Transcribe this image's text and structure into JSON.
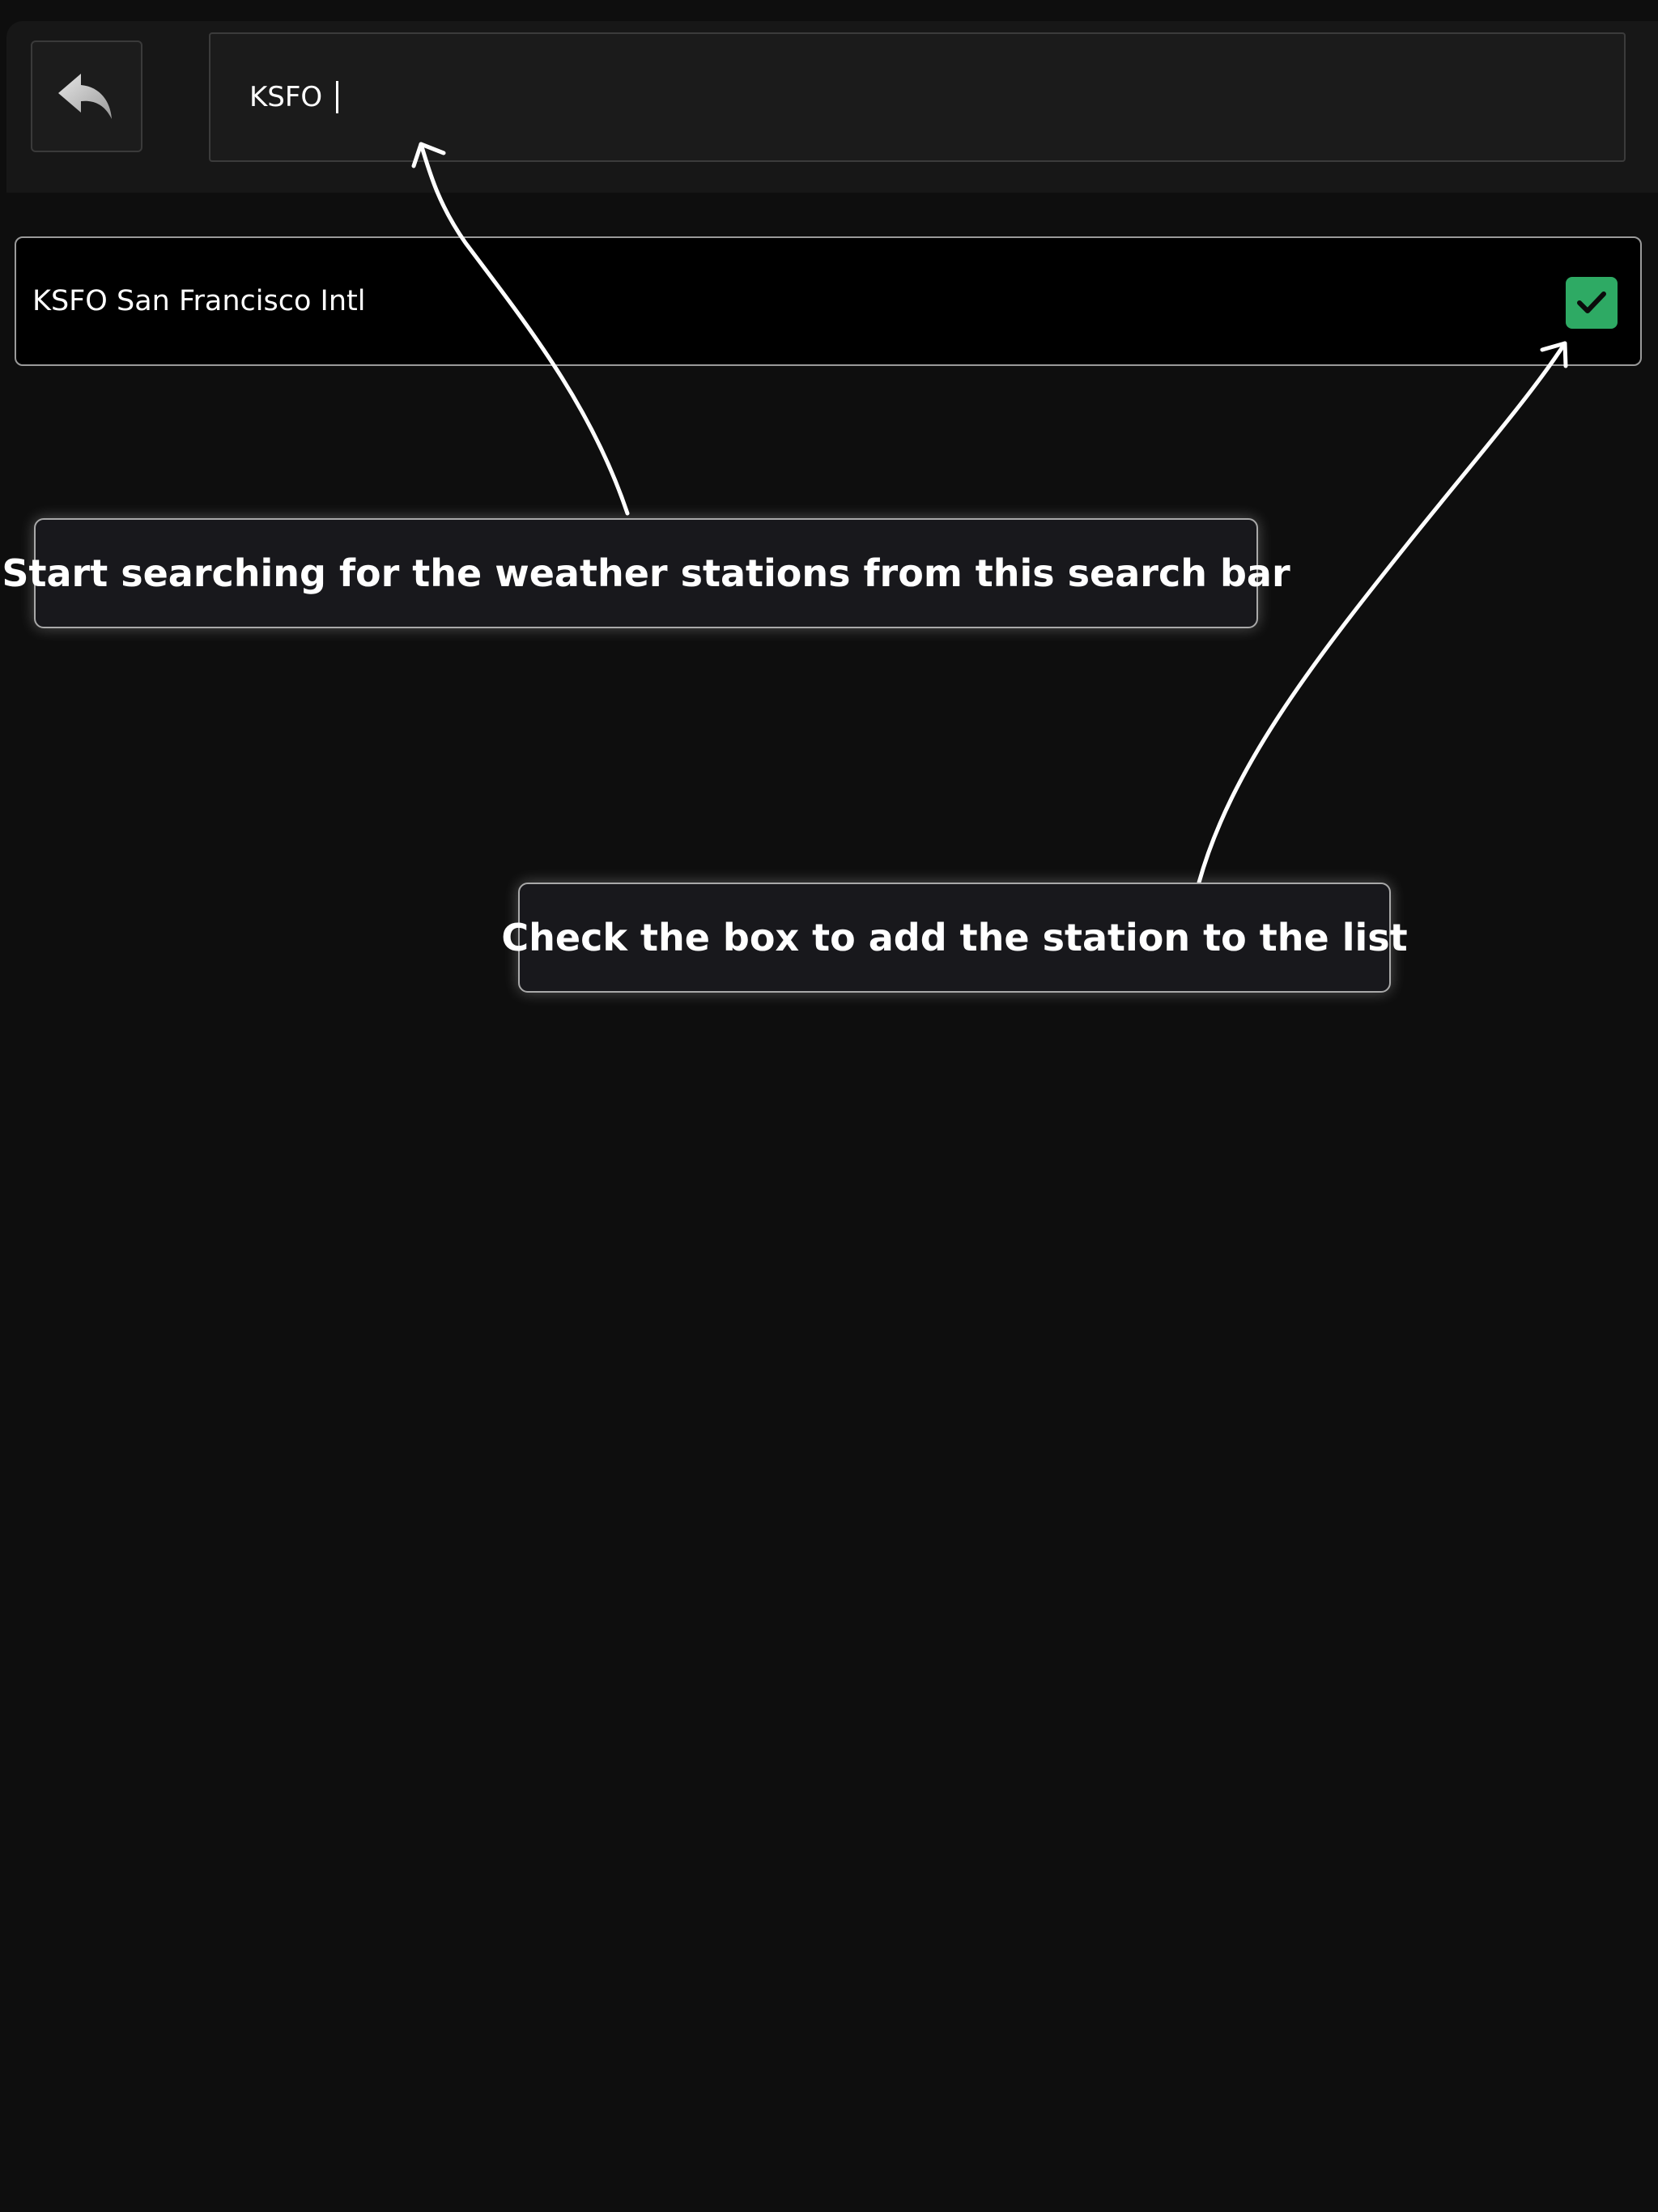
{
  "header": {
    "back_button": {
      "icon": "reply-arrow-icon"
    },
    "search": {
      "value": "KSFO "
    }
  },
  "results": [
    {
      "label": "KSFO San Francisco Intl",
      "checked": true,
      "check_color": "#2eaa64"
    }
  ],
  "tutorial": {
    "callouts": [
      {
        "text": "Start searching for the weather stations from this search bar"
      },
      {
        "text": "Check the box to add the station to the list"
      }
    ]
  },
  "colors": {
    "background": "#0e0e0e",
    "header_background": "#171717",
    "accent_green": "#2eaa64"
  }
}
